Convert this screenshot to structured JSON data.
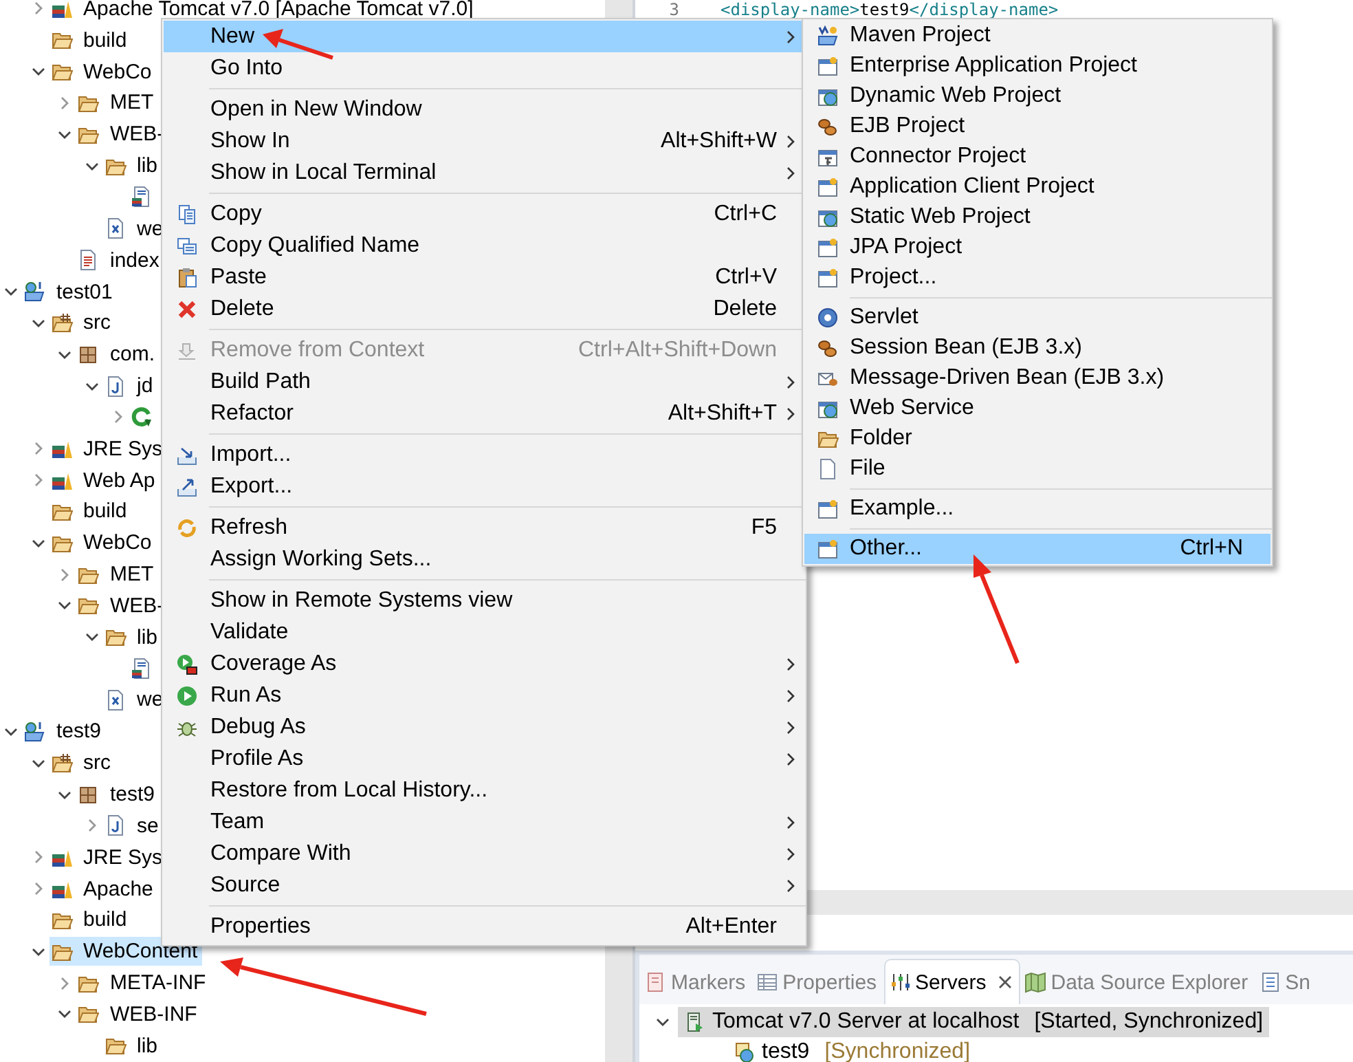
{
  "project_tree": {
    "cut_off_parent": {
      "children": [
        {
          "label": "Apache Tomcat v7.0 [Apache Tomcat v7.0]",
          "kind": "library",
          "expanded": false,
          "selected": false
        },
        {
          "label": "build",
          "kind": "folder",
          "selected": false
        },
        {
          "label": "WebCo",
          "kind": "folder",
          "expanded": true,
          "selected": false,
          "children": [
            {
              "label": "MET",
              "kind": "folder",
              "expanded": false,
              "selected": false
            },
            {
              "label": "WEB-",
              "kind": "folder",
              "expanded": true,
              "selected": false,
              "children": [
                {
                  "label": "lib",
                  "kind": "folder",
                  "expanded": true,
                  "selected": false,
                  "children": [
                    {
                      "kind": "jar",
                      "selected": false
                    }
                  ]
                },
                {
                  "label": "we",
                  "kind": "xml-file",
                  "selected": false
                }
              ]
            },
            {
              "label": "index",
              "kind": "html-file",
              "selected": false
            }
          ]
        }
      ]
    },
    "projects": [
      {
        "label": "test01",
        "kind": "project",
        "expanded": true,
        "selected": false,
        "children": [
          {
            "label": "src",
            "kind": "source-folder",
            "expanded": true,
            "selected": false,
            "children": [
              {
                "label": "com.",
                "kind": "package",
                "expanded": true,
                "selected": false,
                "children": [
                  {
                    "label": "jd",
                    "kind": "java-file",
                    "expanded": true,
                    "selected": false,
                    "children": [
                      {
                        "kind": "class",
                        "expanded": false,
                        "selected": false
                      }
                    ]
                  }
                ]
              }
            ]
          },
          {
            "label": "JRE Sys",
            "kind": "library",
            "expanded": false,
            "selected": false
          },
          {
            "label": "Web Ap",
            "kind": "library",
            "expanded": false,
            "selected": false
          },
          {
            "label": "build",
            "kind": "folder",
            "selected": false
          },
          {
            "label": "WebCo",
            "kind": "folder",
            "expanded": true,
            "selected": false,
            "children": [
              {
                "label": "MET",
                "kind": "folder",
                "expanded": false,
                "selected": false
              },
              {
                "label": "WEB-",
                "kind": "folder",
                "expanded": true,
                "selected": false,
                "children": [
                  {
                    "label": "lib",
                    "kind": "folder",
                    "expanded": true,
                    "selected": false,
                    "children": [
                      {
                        "kind": "jar",
                        "selected": false
                      }
                    ]
                  },
                  {
                    "label": "we",
                    "kind": "xml-file",
                    "selected": false
                  }
                ]
              }
            ]
          }
        ]
      },
      {
        "label": "test9",
        "kind": "project",
        "expanded": true,
        "selected": false,
        "children": [
          {
            "label": "src",
            "kind": "source-folder",
            "expanded": true,
            "selected": false,
            "children": [
              {
                "label": "test9",
                "kind": "package",
                "expanded": true,
                "selected": false,
                "children": [
                  {
                    "label": "se",
                    "kind": "java-file",
                    "expanded": false,
                    "selected": false
                  }
                ]
              }
            ]
          },
          {
            "label": "JRE Sys",
            "kind": "library",
            "expanded": false,
            "selected": false
          },
          {
            "label": "Apache",
            "kind": "library",
            "expanded": false,
            "selected": false
          },
          {
            "label": "build",
            "kind": "folder",
            "selected": false
          },
          {
            "label": "WebContent",
            "kind": "folder",
            "expanded": true,
            "selected": true,
            "children": [
              {
                "label": "META-INF",
                "kind": "folder",
                "expanded": false,
                "selected": false
              },
              {
                "label": "WEB-INF",
                "kind": "folder",
                "expanded": true,
                "selected": false,
                "children": [
                  {
                    "label": "lib",
                    "kind": "folder",
                    "selected": false
                  }
                ]
              }
            ]
          }
        ]
      }
    ]
  },
  "editor": {
    "lines": [
      {
        "number": "3",
        "parts": [
          {
            "text": "<display-name>",
            "kind": "tag"
          },
          {
            "text": "test9",
            "kind": "text"
          },
          {
            "text": "</display-name>",
            "kind": "tag"
          }
        ]
      }
    ]
  },
  "context_menu": {
    "items": [
      {
        "kind": "plain",
        "label": "New",
        "submenu": true,
        "selected": true,
        "disabled": false
      },
      {
        "kind": "plain",
        "label": "Go Into",
        "submenu": false,
        "selected": false,
        "disabled": false
      },
      {
        "kind": "separator"
      },
      {
        "kind": "plain",
        "label": "Open in New Window",
        "submenu": false,
        "selected": false,
        "disabled": false
      },
      {
        "kind": "plain",
        "label": "Show In",
        "shortcut": "Alt+Shift+W",
        "submenu": true,
        "selected": false,
        "disabled": false
      },
      {
        "kind": "plain",
        "label": "Show in Local Terminal",
        "submenu": true,
        "selected": false,
        "disabled": false
      },
      {
        "kind": "separator"
      },
      {
        "kind": "copy",
        "label": "Copy",
        "shortcut": "Ctrl+C",
        "submenu": false,
        "selected": false,
        "disabled": false
      },
      {
        "kind": "copy-name",
        "label": "Copy Qualified Name",
        "submenu": false,
        "selected": false,
        "disabled": false
      },
      {
        "kind": "paste",
        "label": "Paste",
        "shortcut": "Ctrl+V",
        "submenu": false,
        "selected": false,
        "disabled": false
      },
      {
        "kind": "delete",
        "label": "Delete",
        "shortcut": "Delete",
        "submenu": false,
        "selected": false,
        "disabled": false
      },
      {
        "kind": "separator"
      },
      {
        "kind": "remove",
        "label": "Remove from Context",
        "shortcut": "Ctrl+Alt+Shift+Down",
        "submenu": false,
        "selected": false,
        "disabled": true
      },
      {
        "kind": "plain",
        "label": "Build Path",
        "submenu": true,
        "selected": false,
        "disabled": false
      },
      {
        "kind": "plain",
        "label": "Refactor",
        "shortcut": "Alt+Shift+T",
        "submenu": true,
        "selected": false,
        "disabled": false
      },
      {
        "kind": "separator"
      },
      {
        "kind": "import",
        "label": "Import...",
        "submenu": false,
        "selected": false,
        "disabled": false
      },
      {
        "kind": "export",
        "label": "Export...",
        "submenu": false,
        "selected": false,
        "disabled": false
      },
      {
        "kind": "separator"
      },
      {
        "kind": "refresh",
        "label": "Refresh",
        "shortcut": "F5",
        "submenu": false,
        "selected": false,
        "disabled": false
      },
      {
        "kind": "plain",
        "label": "Assign Working Sets...",
        "submenu": false,
        "selected": false,
        "disabled": false
      },
      {
        "kind": "separator"
      },
      {
        "kind": "plain",
        "label": "Show in Remote Systems view",
        "submenu": false,
        "selected": false,
        "disabled": false
      },
      {
        "kind": "plain",
        "label": "Validate",
        "submenu": false,
        "selected": false,
        "disabled": false
      },
      {
        "kind": "coverage",
        "label": "Coverage As",
        "submenu": true,
        "selected": false,
        "disabled": false
      },
      {
        "kind": "run",
        "label": "Run As",
        "submenu": true,
        "selected": false,
        "disabled": false
      },
      {
        "kind": "debug",
        "label": "Debug As",
        "submenu": true,
        "selected": false,
        "disabled": false
      },
      {
        "kind": "plain",
        "label": "Profile As",
        "submenu": true,
        "selected": false,
        "disabled": false
      },
      {
        "kind": "plain",
        "label": "Restore from Local History...",
        "submenu": false,
        "selected": false,
        "disabled": false
      },
      {
        "kind": "plain",
        "label": "Team",
        "submenu": true,
        "selected": false,
        "disabled": false
      },
      {
        "kind": "plain",
        "label": "Compare With",
        "submenu": true,
        "selected": false,
        "disabled": false
      },
      {
        "kind": "plain",
        "label": "Source",
        "submenu": true,
        "selected": false,
        "disabled": false
      },
      {
        "kind": "separator"
      },
      {
        "kind": "plain",
        "label": "Properties",
        "shortcut": "Alt+Enter",
        "submenu": false,
        "selected": false,
        "disabled": false
      }
    ]
  },
  "new_submenu": {
    "items": [
      {
        "kind": "maven",
        "label": "Maven Project",
        "selected": false
      },
      {
        "kind": "window",
        "label": "Enterprise Application Project",
        "selected": false
      },
      {
        "kind": "globe",
        "label": "Dynamic Web Project",
        "selected": false
      },
      {
        "kind": "beans",
        "label": "EJB Project",
        "selected": false
      },
      {
        "kind": "plug",
        "label": "Connector Project",
        "selected": false
      },
      {
        "kind": "window",
        "label": "Application Client Project",
        "selected": false
      },
      {
        "kind": "globe",
        "label": "Static Web Project",
        "selected": false
      },
      {
        "kind": "window",
        "label": "JPA Project",
        "selected": false
      },
      {
        "kind": "window",
        "label": "Project...",
        "selected": false
      },
      {
        "kind": "separator"
      },
      {
        "kind": "circle",
        "label": "Servlet",
        "selected": false
      },
      {
        "kind": "beans",
        "label": "Session Bean (EJB 3.x)",
        "selected": false
      },
      {
        "kind": "envelope",
        "label": "Message-Driven Bean (EJB 3.x)",
        "selected": false
      },
      {
        "kind": "globe",
        "label": "Web Service",
        "selected": false
      },
      {
        "kind": "folder",
        "label": "Folder",
        "selected": false
      },
      {
        "kind": "file",
        "label": "File",
        "selected": false
      },
      {
        "kind": "separator"
      },
      {
        "kind": "window",
        "label": "Example...",
        "selected": false
      },
      {
        "kind": "separator"
      },
      {
        "kind": "window",
        "label": "Other...",
        "shortcut": "Ctrl+N",
        "selected": true
      }
    ]
  },
  "bottom_panel": {
    "tabs": [
      {
        "kind": "markers",
        "label": "Markers",
        "selected": false
      },
      {
        "kind": "table",
        "label": "Properties",
        "selected": false
      },
      {
        "kind": "sliders",
        "label": "Servers",
        "selected": true
      },
      {
        "kind": "map",
        "label": "Data Source Explorer",
        "selected": false
      },
      {
        "kind": "list",
        "label": "Sn",
        "selected": false
      }
    ],
    "servers": [
      {
        "label": "Tomcat v7.0 Server at localhost",
        "status": "[Started, Synchronized]",
        "expanded": true,
        "selected": true,
        "children": [
          {
            "label": "test9",
            "status": "[Synchronized]",
            "selected": false
          }
        ]
      }
    ]
  }
}
